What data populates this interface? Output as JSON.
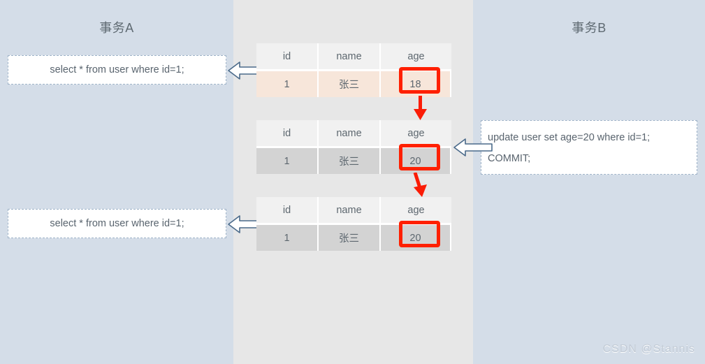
{
  "panels": {
    "left": {
      "title": "事务A"
    },
    "right": {
      "title": "事务B"
    }
  },
  "sql_boxes": {
    "a_first": {
      "text": "select * from user where id=1;"
    },
    "a_second": {
      "text": "select * from user where id=1;"
    },
    "b": {
      "line1": "update user set age=20 where id=1;",
      "line2": "COMMIT;"
    }
  },
  "tables": [
    {
      "id": "table1",
      "row_style": "peach",
      "headers": [
        "id",
        "name",
        "age"
      ],
      "row": [
        "1",
        "张三",
        "18"
      ],
      "highlight_column": "age",
      "highlight_value": "18"
    },
    {
      "id": "table2",
      "row_style": "gray",
      "headers": [
        "id",
        "name",
        "age"
      ],
      "row": [
        "1",
        "张三",
        "20"
      ],
      "highlight_column": "age",
      "highlight_value": "20"
    },
    {
      "id": "table3",
      "row_style": "gray",
      "headers": [
        "id",
        "name",
        "age"
      ],
      "row": [
        "1",
        "张三",
        "20"
      ],
      "highlight_column": "age",
      "highlight_value": "20"
    }
  ],
  "arrows": {
    "block_left_1": "left-block-arrow",
    "block_left_2": "left-block-arrow",
    "block_left_3": "left-block-arrow",
    "red_down_1": "red-down-arrow",
    "red_down_2": "red-down-arrow"
  },
  "watermark": {
    "text": "CSDN @Stannis"
  },
  "colors": {
    "panel": "#d4dde8",
    "center_background": "#e7e7e7",
    "highlight_red": "#ff2000",
    "peach_row": "#f7e6da",
    "gray_row": "#d3d3d3",
    "arrow_outline": "#4a6a8a",
    "text": "#5d676f"
  }
}
